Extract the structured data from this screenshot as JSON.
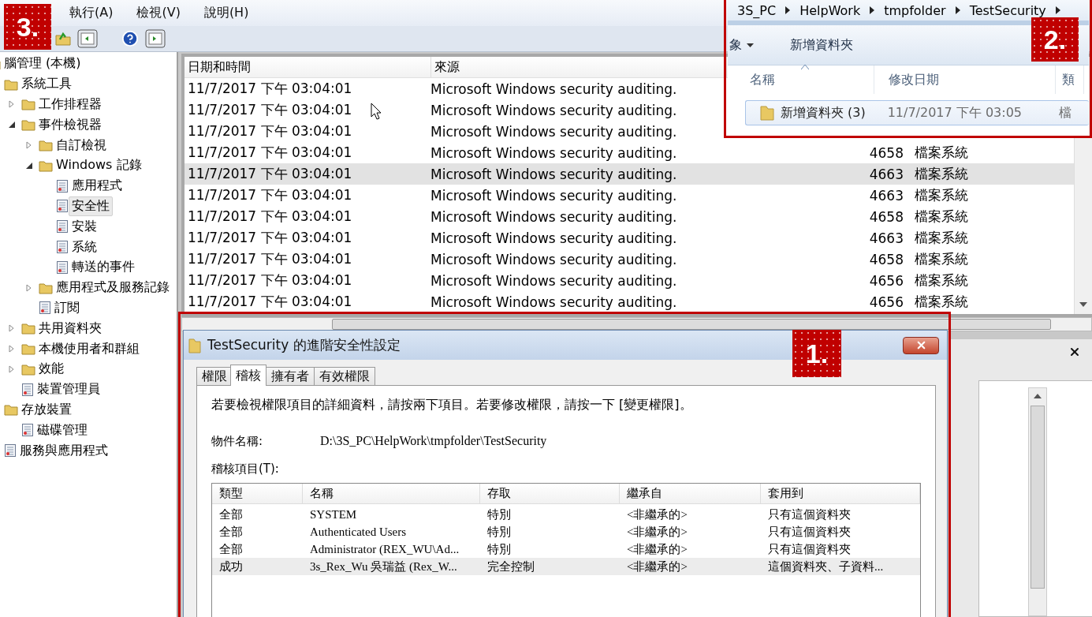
{
  "console": {
    "badge": "3.",
    "menu": [
      "執行(A)",
      "檢視(V)",
      "說明(H)"
    ],
    "tree": [
      {
        "label": "腦管理 (本機)",
        "selected": false,
        "children": [
          {
            "label": "系統工具",
            "selected": false,
            "children": [
              {
                "label": "工作排程器",
                "selected": false,
                "expanded": false
              },
              {
                "label": "事件檢視器",
                "selected": false,
                "expanded": true,
                "children": [
                  {
                    "label": "自訂檢視",
                    "selected": false,
                    "expanded": false
                  },
                  {
                    "label": "Windows 記錄",
                    "selected": false,
                    "expanded": true,
                    "children": [
                      {
                        "label": "應用程式",
                        "selected": false
                      },
                      {
                        "label": "安全性",
                        "selected": true
                      },
                      {
                        "label": "安裝",
                        "selected": false
                      },
                      {
                        "label": "系統",
                        "selected": false
                      },
                      {
                        "label": "轉送的事件",
                        "selected": false
                      }
                    ]
                  },
                  {
                    "label": "應用程式及服務記錄",
                    "selected": false,
                    "expanded": false
                  },
                  {
                    "label": "訂閱",
                    "selected": false
                  }
                ]
              },
              {
                "label": "共用資料夾",
                "selected": false,
                "expanded": false
              },
              {
                "label": "本機使用者和群組",
                "selected": false,
                "expanded": false
              },
              {
                "label": "效能",
                "selected": false,
                "expanded": false
              },
              {
                "label": "裝置管理員",
                "selected": false
              }
            ]
          },
          {
            "label": "存放裝置",
            "selected": false,
            "children": [
              {
                "label": "磁碟管理",
                "selected": false
              }
            ]
          },
          {
            "label": "服務與應用程式",
            "selected": false
          }
        ]
      }
    ],
    "event_columns": [
      "日期和時間",
      "來源"
    ],
    "events": [
      {
        "date": "11/7/2017 下午 03:04:01",
        "source": "Microsoft Windows security auditing.",
        "selected": false
      },
      {
        "date": "11/7/2017 下午 03:04:01",
        "source": "Microsoft Windows security auditing.",
        "selected": false
      },
      {
        "date": "11/7/2017 下午 03:04:01",
        "source": "Microsoft Windows security auditing.",
        "selected": false
      },
      {
        "date": "11/7/2017 下午 03:04:01",
        "source": "Microsoft Windows security auditing.",
        "event_id": "4658",
        "category": "檔案系統",
        "selected": false
      },
      {
        "date": "11/7/2017 下午 03:04:01",
        "source": "Microsoft Windows security auditing.",
        "event_id": "4663",
        "category": "檔案系統",
        "selected": true
      },
      {
        "date": "11/7/2017 下午 03:04:01",
        "source": "Microsoft Windows security auditing.",
        "event_id": "4663",
        "category": "檔案系統",
        "selected": false
      },
      {
        "date": "11/7/2017 下午 03:04:01",
        "source": "Microsoft Windows security auditing.",
        "event_id": "4658",
        "category": "檔案系統",
        "selected": false
      },
      {
        "date": "11/7/2017 下午 03:04:01",
        "source": "Microsoft Windows security auditing.",
        "event_id": "4663",
        "category": "檔案系統",
        "selected": false
      },
      {
        "date": "11/7/2017 下午 03:04:01",
        "source": "Microsoft Windows security auditing.",
        "event_id": "4658",
        "category": "檔案系統",
        "selected": false
      },
      {
        "date": "11/7/2017 下午 03:04:01",
        "source": "Microsoft Windows security auditing.",
        "event_id": "4656",
        "category": "檔案系統",
        "selected": false
      },
      {
        "date": "11/7/2017 下午 03:04:01",
        "source": "Microsoft Windows security auditing.",
        "event_id": "4656",
        "category": "檔案系統",
        "selected": false
      }
    ]
  },
  "explorer": {
    "badge": "2.",
    "breadcrumb": [
      "3S_PC",
      "HelpWork",
      "tmpfolder",
      "TestSecurity"
    ],
    "toolbar": [
      {
        "label": "象",
        "kind": "dropdown"
      },
      {
        "label": "新增資料夾",
        "kind": "button"
      }
    ],
    "columns": [
      {
        "label": "名稱",
        "sorted": true
      },
      {
        "label": "修改日期",
        "sorted": false
      },
      {
        "label": "類",
        "sorted": false
      }
    ],
    "files": [
      {
        "name": "新增資料夾 (3)",
        "modified": "11/7/2017 下午 03:05",
        "type": "檔",
        "selected": true
      }
    ]
  },
  "dialog": {
    "badge": "1.",
    "title": "TestSecurity 的進階安全性設定",
    "tabs": [
      {
        "label": "權限",
        "selected": false
      },
      {
        "label": "稽核",
        "selected": true
      },
      {
        "label": "擁有者",
        "selected": false
      },
      {
        "label": "有效權限",
        "selected": false
      }
    ],
    "description": "若要檢視權限項目的詳細資料，請按兩下項目。若要修改權限，請按一下 [變更權限]。",
    "object_label": "物件名稱:",
    "object_value": "D:\\3S_PC\\HelpWork\\tmpfolder\\TestSecurity",
    "entries_label": "稽核項目(T):",
    "columns": [
      "類型",
      "名稱",
      "存取",
      "繼承自",
      "套用到"
    ],
    "entries": [
      {
        "cells": [
          "全部",
          "SYSTEM",
          "特別",
          "<非繼承的>",
          "只有這個資料夾"
        ],
        "selected": false
      },
      {
        "cells": [
          "全部",
          "Authenticated Users",
          "特別",
          "<非繼承的>",
          "只有這個資料夾"
        ],
        "selected": false
      },
      {
        "cells": [
          "全部",
          "Administrator (REX_WU\\Ad...",
          "特別",
          "<非繼承的>",
          "只有這個資料夾"
        ],
        "selected": false
      },
      {
        "cells": [
          "成功",
          "3s_Rex_Wu 吳瑞益 (Rex_W...",
          "完全控制",
          "<非繼承的>",
          "這個資料夾、子資料..."
        ],
        "selected": true
      }
    ]
  }
}
